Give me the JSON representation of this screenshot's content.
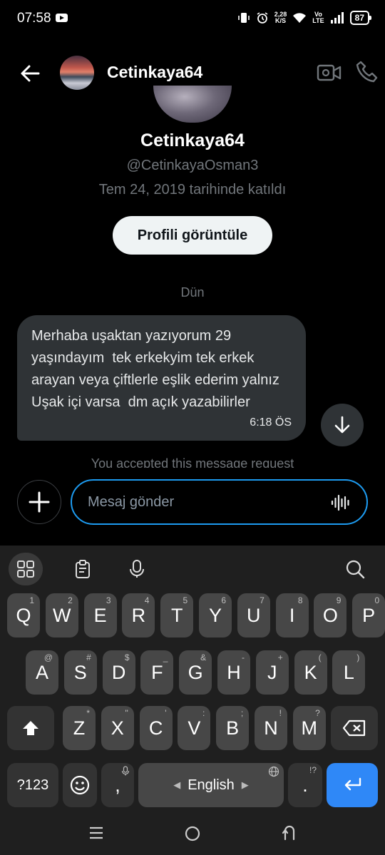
{
  "status_bar": {
    "time": "07:58",
    "net_speed_value": "2,28",
    "net_speed_unit": "K/S",
    "volte_top": "Vo",
    "volte_bottom": "LTE",
    "battery": "87"
  },
  "header": {
    "title": "Cetinkaya64",
    "icons": [
      "back-arrow-icon",
      "video-icon",
      "phone-icon"
    ]
  },
  "profile": {
    "name": "Cetinkaya64",
    "handle": "@CetinkayaOsman3",
    "joined": "Tem 24, 2019 tarihinde katıldı",
    "view_profile_label": "Profili görüntüle"
  },
  "conversation": {
    "day_label": "Dün",
    "messages": [
      {
        "text": "Merhaba uşaktan yazıyorum 29 yaşındayım  tek erkekyim tek erkek arayan veya çiftlerle eşlik ederim yalnız Uşak içi varsa  dm açık yazabilirler",
        "time": "6:18 ÖS"
      }
    ],
    "notice": "You accepted this message request"
  },
  "composer": {
    "placeholder": "Mesaj gönder"
  },
  "keyboard": {
    "row1": [
      {
        "label": "Q",
        "hint": "1"
      },
      {
        "label": "W",
        "hint": "2"
      },
      {
        "label": "E",
        "hint": "3"
      },
      {
        "label": "R",
        "hint": "4"
      },
      {
        "label": "T",
        "hint": "5"
      },
      {
        "label": "Y",
        "hint": "6"
      },
      {
        "label": "U",
        "hint": "7"
      },
      {
        "label": "I",
        "hint": "8"
      },
      {
        "label": "O",
        "hint": "9"
      },
      {
        "label": "P",
        "hint": "0"
      }
    ],
    "row2": [
      {
        "label": "A",
        "hint": "@"
      },
      {
        "label": "S",
        "hint": "#"
      },
      {
        "label": "D",
        "hint": "$"
      },
      {
        "label": "F",
        "hint": "_"
      },
      {
        "label": "G",
        "hint": "&"
      },
      {
        "label": "H",
        "hint": "-"
      },
      {
        "label": "J",
        "hint": "+"
      },
      {
        "label": "K",
        "hint": "("
      },
      {
        "label": "L",
        "hint": ")"
      }
    ],
    "row3": [
      {
        "label": "Z",
        "hint": "*"
      },
      {
        "label": "X",
        "hint": "\""
      },
      {
        "label": "C",
        "hint": "'"
      },
      {
        "label": "V",
        "hint": ":"
      },
      {
        "label": "B",
        "hint": ";"
      },
      {
        "label": "N",
        "hint": "!"
      },
      {
        "label": "M",
        "hint": "?"
      }
    ],
    "symbols_label": "?123",
    "comma_label": ",",
    "space_label": "English",
    "period_label": ".",
    "period_hint": "!?"
  }
}
